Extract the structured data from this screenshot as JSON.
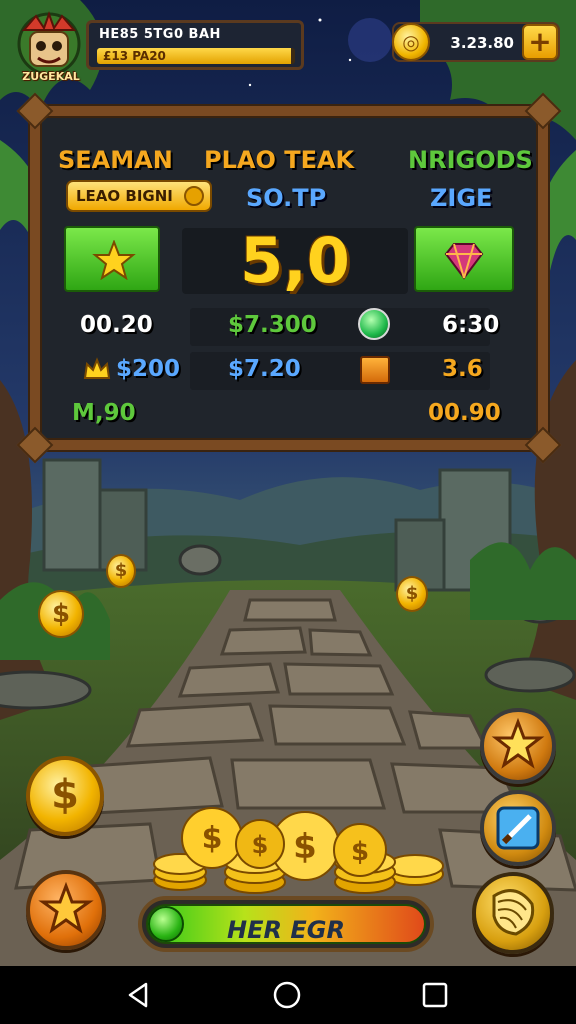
{
  "player": {
    "name": "ZUGEKAL",
    "title": "HE85 5TG0 BAH",
    "bar_text": "£13 PA20",
    "bar_progress": 0.98
  },
  "currency": {
    "value": "3.23.80",
    "icon": "gold-coin-icon"
  },
  "board": {
    "columns": [
      {
        "header": "SEAMAN",
        "color": "#f5a81f"
      },
      {
        "header": "PLAO TEAK",
        "color": "#f5a81f"
      },
      {
        "header": "NRIGODS",
        "color": "#5ec83c"
      }
    ],
    "badge": "LEAO BIGNI",
    "sub_left": "SO.TP",
    "sub_right": "ZIGE",
    "big_value": "5,0",
    "rows": [
      {
        "left": "00.20",
        "center": "$7.300",
        "right": "6:30"
      },
      {
        "left": "$200",
        "center": "$7.20",
        "right": "3.6"
      },
      {
        "left": "M,90",
        "right": "00.90"
      }
    ]
  },
  "progress": {
    "label": "HER EGR"
  },
  "colors": {
    "accent_gold": "#ffd21e",
    "green": "#5ec83c",
    "blue": "#5aa8ff",
    "wood": "#7a4a22"
  }
}
